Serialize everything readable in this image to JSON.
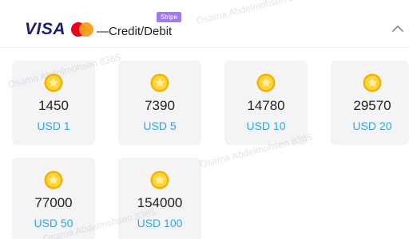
{
  "payment_method": {
    "brand_text": "VISA",
    "label": "—Credit/Debit",
    "badge": "Stripe",
    "collapse_icon": "chevron-up-icon"
  },
  "packages": [
    {
      "amount": "1450",
      "price": "USD 1"
    },
    {
      "amount": "7390",
      "price": "USD 5"
    },
    {
      "amount": "14780",
      "price": "USD 10"
    },
    {
      "amount": "29570",
      "price": "USD 20"
    },
    {
      "amount": "77000",
      "price": "USD 50"
    },
    {
      "amount": "154000",
      "price": "USD 100"
    }
  ],
  "watermark_text": "Osama Abdelmohsen 8385",
  "colors": {
    "card_bg": "#f4f4f6",
    "price_blue": "#2ea5e8",
    "stripe_purple": "#9f7aea",
    "visa_blue": "#1a1f71",
    "coin_gold": "#f5c518"
  }
}
